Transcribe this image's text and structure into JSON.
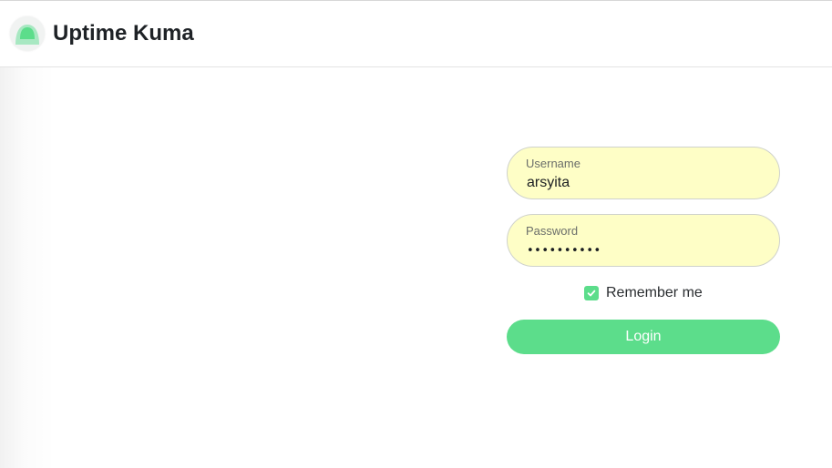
{
  "app": {
    "title": "Uptime Kuma",
    "logo_icon": "uptime-kuma-logo-icon"
  },
  "login": {
    "username": {
      "label": "Username",
      "value": "arsyita"
    },
    "password": {
      "label": "Password",
      "value": "••••••••••"
    },
    "remember": {
      "label": "Remember me",
      "checked": true
    },
    "submit_label": "Login"
  },
  "colors": {
    "accent": "#5cdd8b",
    "input_background": "#fefec6",
    "title_text": "#1e2226"
  }
}
